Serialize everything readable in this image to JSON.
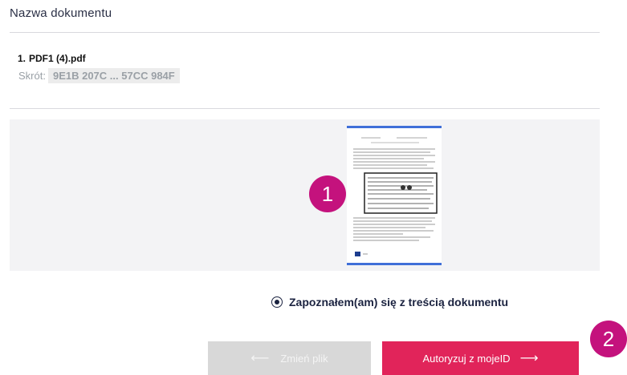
{
  "header": {
    "title": "Nazwa dokumentu"
  },
  "document": {
    "index": "1.",
    "name": "PDF1 (4).pdf",
    "hash_label": "Skrót:",
    "hash_value": "9E1B 207C ... 57CC 984F"
  },
  "preview": {
    "page_count": 1
  },
  "badges": {
    "first": "1",
    "second": "2"
  },
  "confirm": {
    "label": "Zapoznałem(am) się z treścią dokumentu",
    "selected": true
  },
  "buttons": {
    "change_file": {
      "label": "Zmień plik",
      "icon": "arrow-left-icon",
      "enabled": false
    },
    "authorize": {
      "label": "Autoryzuj z mojeID",
      "icon": "arrow-right-icon"
    }
  },
  "colors": {
    "accent": "#e1245a",
    "badge": "#c4127d",
    "disabled": "#d8d8d8",
    "preview_border": "#3f6fd8"
  }
}
